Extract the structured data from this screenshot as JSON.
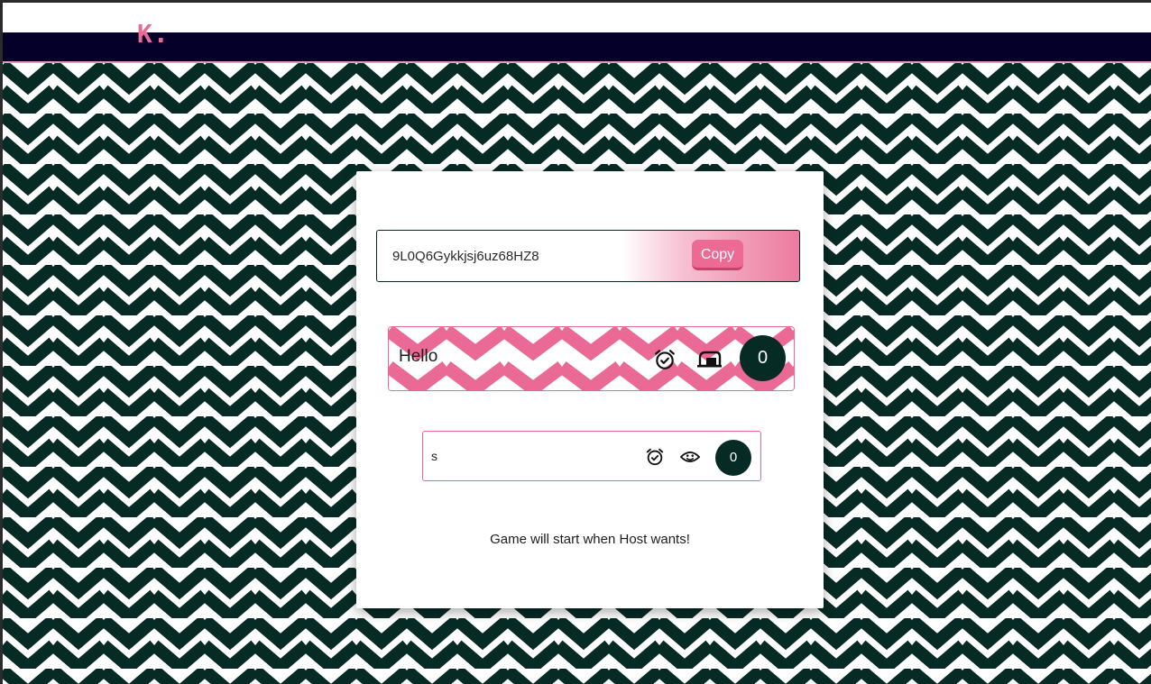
{
  "app": {
    "logo_text": "K."
  },
  "room": {
    "code": "9L0Q6Gykkjsj6uz68HZ8",
    "copy_label": "Copy"
  },
  "players": [
    {
      "name": "Hello",
      "score": "0",
      "role_icon": "mailbox-icon",
      "timer_icon": "alarm-icon"
    },
    {
      "name": "s",
      "score": "0",
      "role_icon": "smiley-icon",
      "timer_icon": "alarm-icon"
    }
  ],
  "status": "Game will start when Host wants!",
  "colors": {
    "accent": "#ea6a95",
    "navbar": "#05002a",
    "dark_green": "#062b25",
    "pattern_dark": "#062b25"
  }
}
